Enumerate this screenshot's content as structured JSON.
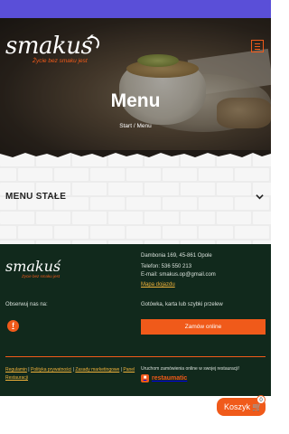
{
  "colors": {
    "top_bar": "#5a4fd8",
    "accent": "#f05a1a",
    "footer_bg": "#11291c",
    "link": "#f0b23a"
  },
  "header": {
    "logo_word": "smakuś",
    "logo_tagline": "Życie bez smaku jest",
    "menu_icon": "hamburger-icon"
  },
  "hero": {
    "title": "Menu",
    "breadcrumb": {
      "home": "Start",
      "separator": "/",
      "current": "Menu"
    }
  },
  "section": {
    "label": "MENU STAŁE",
    "toggle_icon": "chevron-down-icon"
  },
  "footer": {
    "logo_word": "smakuś",
    "logo_tagline": "Życie bez smaku jest",
    "address": "Dambonia 169, 45-861 Opole",
    "phone": "Telefon: 536 550 213",
    "email": "E-mail: smakus.op@gmail.com",
    "map_link": "Mapa dojazdu",
    "follow_label": "Obserwuj nas na:",
    "facebook_icon": "facebook-icon",
    "payment_text": "Gotówka, karta lub szybki przelew",
    "order_button": "Zamów online",
    "legal_links": [
      "Regulamin",
      "Polityka prywatności",
      "Zasady marketingowe",
      "Panel Restauracji"
    ],
    "online_note": "Uruchom zamówienia online w swojej restauracji!",
    "restaumatic": "restaumatic"
  },
  "cart": {
    "label": "Koszyk",
    "count": "0",
    "icon": "cart-icon"
  }
}
